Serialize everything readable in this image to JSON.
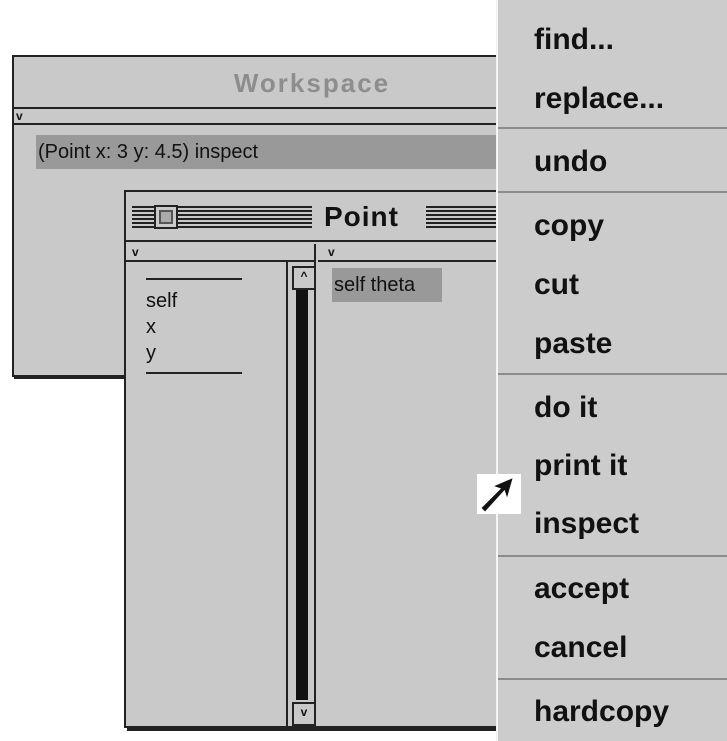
{
  "workspace": {
    "title": "Workspace",
    "text": "(Point x: 3 y: 4.5) inspect"
  },
  "inspector": {
    "title": "Point",
    "variables": [
      "self",
      "x",
      "y"
    ],
    "selected_text": "self theta"
  },
  "menu": {
    "items": [
      {
        "label": "find..."
      },
      {
        "label": "replace..."
      },
      {
        "label": "undo"
      },
      {
        "label": "copy"
      },
      {
        "label": "cut"
      },
      {
        "label": "paste"
      },
      {
        "label": "do it"
      },
      {
        "label": "print it"
      },
      {
        "label": "inspect"
      },
      {
        "label": "accept"
      },
      {
        "label": "cancel"
      },
      {
        "label": "hardcopy"
      }
    ]
  },
  "colors": {
    "window_bg": "#c9c9c9",
    "selection": "#999999",
    "menu_bg": "#cccccc",
    "title_dim": "#8d8d8d"
  }
}
